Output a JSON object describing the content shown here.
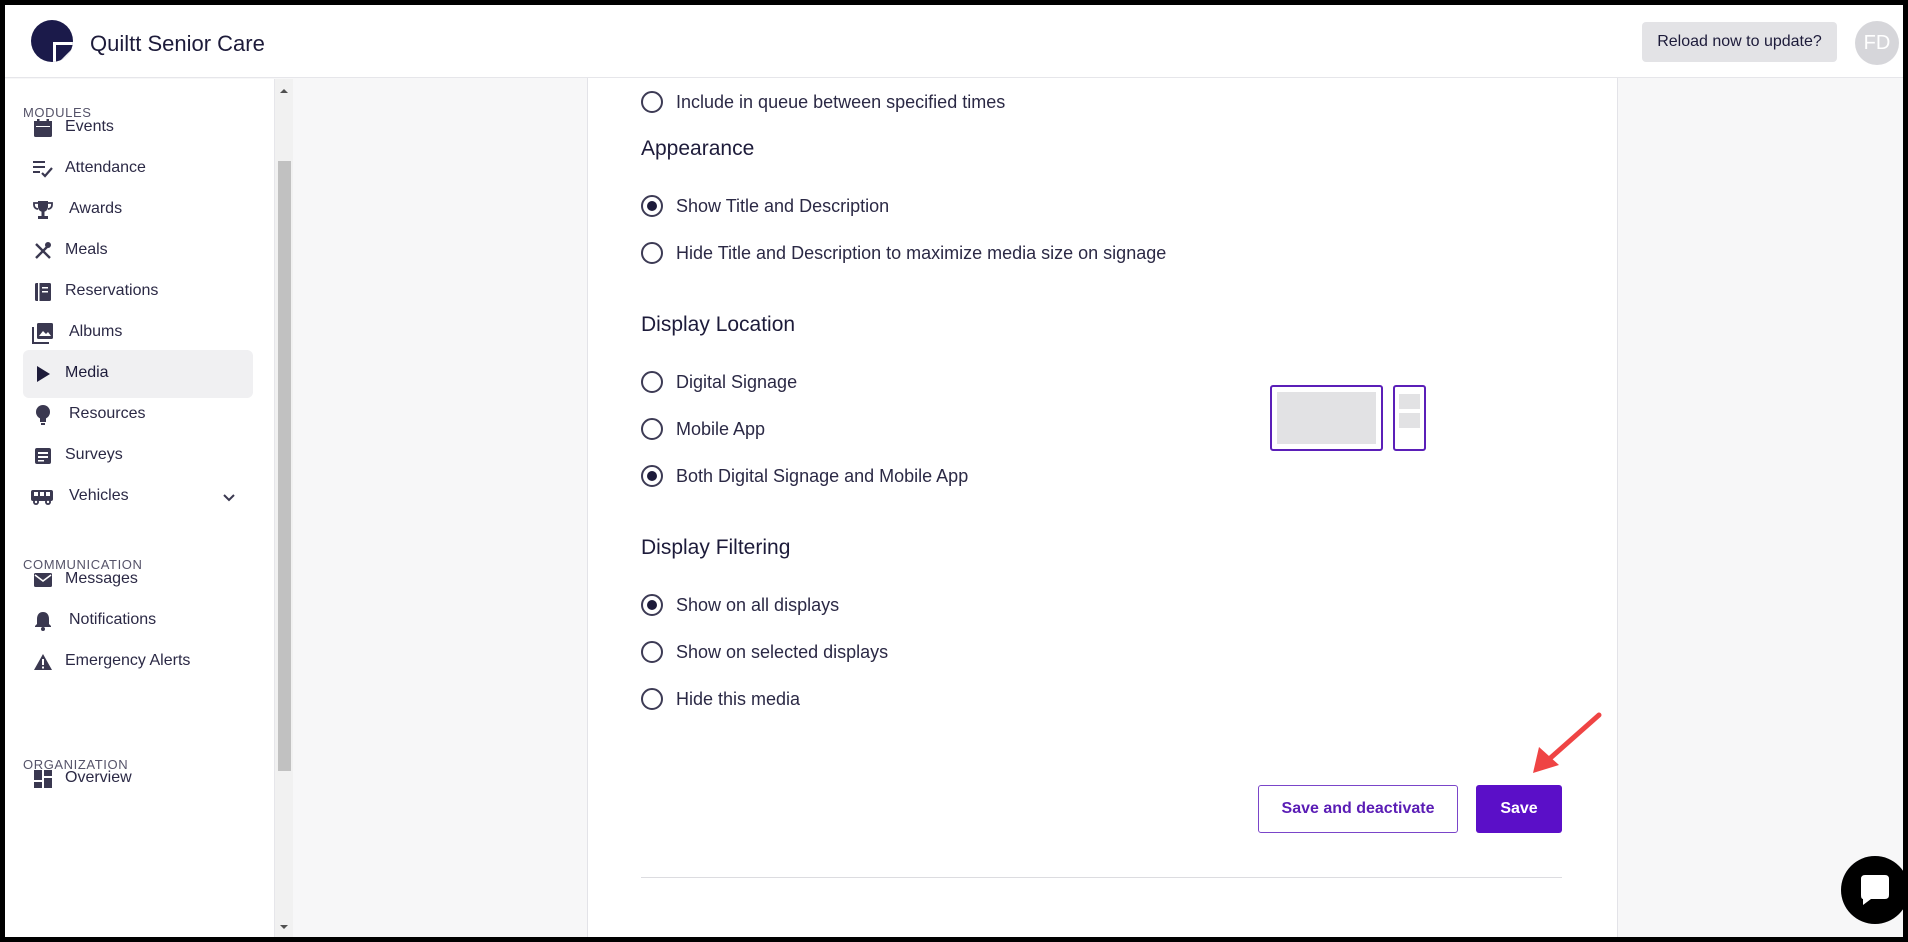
{
  "header": {
    "app_title": "Quiltt Senior Care",
    "reload_label": "Reload now to update?",
    "avatar_initials": "FD"
  },
  "sidebar": {
    "sections": {
      "modules": "MODULES",
      "communication": "COMMUNICATION",
      "organization": "ORGANIZATION"
    },
    "items": [
      {
        "label": "Events",
        "icon": "calendar-icon"
      },
      {
        "label": "Attendance",
        "icon": "checklist-icon"
      },
      {
        "label": "Awards",
        "icon": "trophy-icon"
      },
      {
        "label": "Meals",
        "icon": "utensils-icon"
      },
      {
        "label": "Reservations",
        "icon": "book-icon"
      },
      {
        "label": "Albums",
        "icon": "photo-library-icon"
      },
      {
        "label": "Media",
        "icon": "play-icon",
        "active": true
      },
      {
        "label": "Resources",
        "icon": "lightbulb-icon"
      },
      {
        "label": "Surveys",
        "icon": "survey-icon"
      },
      {
        "label": "Vehicles",
        "icon": "bus-icon",
        "expandable": true
      },
      {
        "label": "Messages",
        "icon": "mail-icon"
      },
      {
        "label": "Notifications",
        "icon": "bell-icon"
      },
      {
        "label": "Emergency Alerts",
        "icon": "warning-icon"
      },
      {
        "label": "Overview",
        "icon": "dashboard-icon"
      }
    ]
  },
  "form": {
    "queue_option": {
      "label": "Include in queue between specified times",
      "selected": false
    },
    "appearance": {
      "title": "Appearance",
      "options": [
        {
          "label": "Show Title and Description",
          "selected": true
        },
        {
          "label": "Hide Title and Description to maximize media size on signage",
          "selected": false
        }
      ]
    },
    "display_location": {
      "title": "Display Location",
      "options": [
        {
          "label": "Digital Signage",
          "selected": false
        },
        {
          "label": "Mobile App",
          "selected": false
        },
        {
          "label": "Both Digital Signage and Mobile App",
          "selected": true
        }
      ]
    },
    "display_filtering": {
      "title": "Display Filtering",
      "options": [
        {
          "label": "Show on all displays",
          "selected": true
        },
        {
          "label": "Show on selected displays",
          "selected": false
        },
        {
          "label": "Hide this media",
          "selected": false
        }
      ]
    },
    "actions": {
      "save_deactivate_label": "Save and deactivate",
      "save_label": "Save"
    }
  },
  "colors": {
    "accent": "#5b0fc8",
    "annotation_arrow": "#ef4444",
    "text_dark": "#1d1b3a"
  }
}
